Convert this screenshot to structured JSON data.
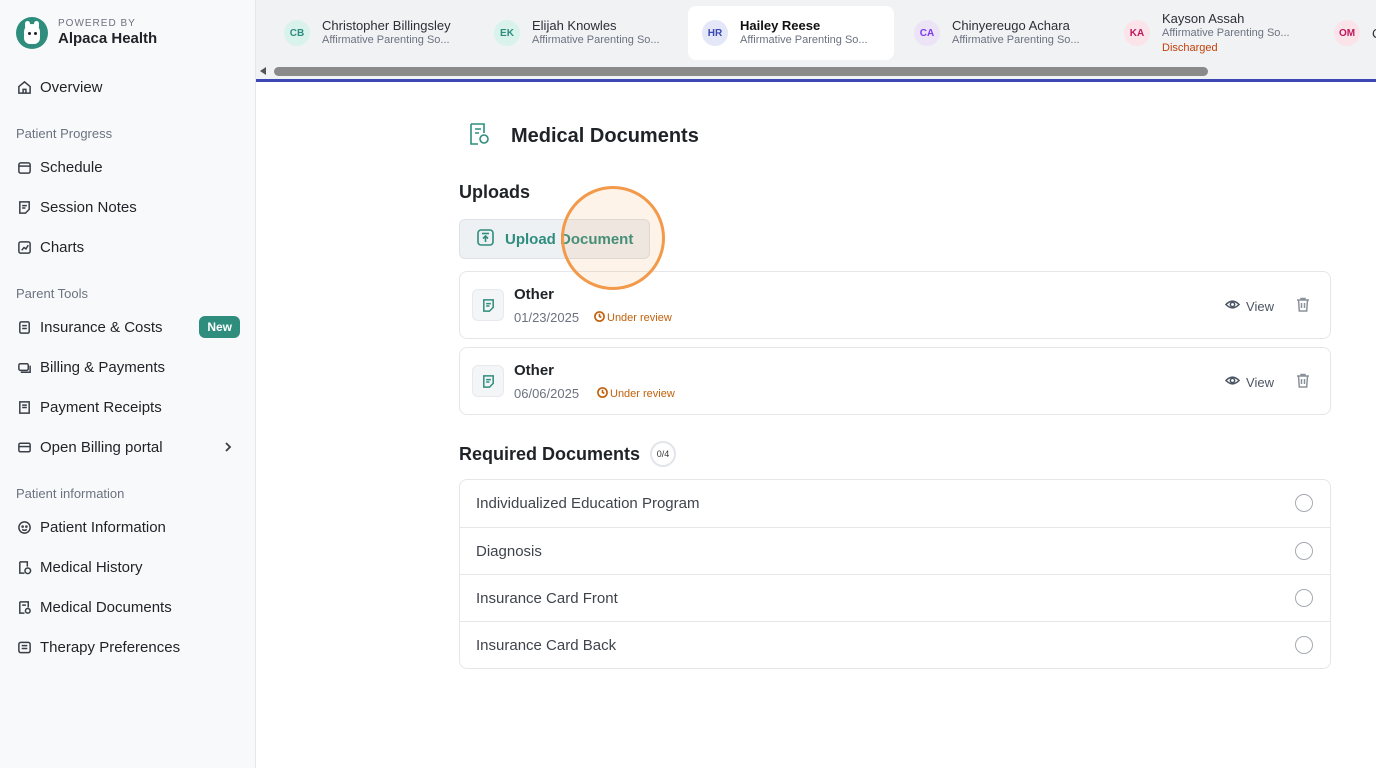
{
  "brand": {
    "powered_by": "POWERED BY",
    "name": "Alpaca Health"
  },
  "sidebar": {
    "overview": "Overview",
    "sections": {
      "progress": "Patient Progress",
      "parent_tools": "Parent Tools",
      "patient_info": "Patient information"
    },
    "items": [
      {
        "label": "Schedule",
        "icon": "calendar-icon"
      },
      {
        "label": "Session Notes",
        "icon": "notes-icon"
      },
      {
        "label": "Charts",
        "icon": "chart-icon"
      },
      {
        "label": "Insurance & Costs",
        "icon": "insurance-icon",
        "badge": "New"
      },
      {
        "label": "Billing & Payments",
        "icon": "billing-icon"
      },
      {
        "label": "Payment Receipts",
        "icon": "receipt-icon"
      },
      {
        "label": "Open Billing portal",
        "icon": "card-icon"
      },
      {
        "label": "Patient Information",
        "icon": "patient-icon"
      },
      {
        "label": "Medical History",
        "icon": "history-icon"
      },
      {
        "label": "Medical Documents",
        "icon": "documents-icon"
      },
      {
        "label": "Therapy Preferences",
        "icon": "preferences-icon"
      }
    ]
  },
  "tabs": [
    {
      "initials": "CB",
      "name": "Christopher Billingsley",
      "org": "Affirmative Parenting So...",
      "bg": "#d9f2ec",
      "fg": "#2f8d7e"
    },
    {
      "initials": "EK",
      "name": "Elijah Knowles",
      "org": "Affirmative Parenting So...",
      "bg": "#d9f2ec",
      "fg": "#2f8d7e"
    },
    {
      "initials": "HR",
      "name": "Hailey Reese",
      "org": "Affirmative Parenting So...",
      "bg": "#e3e7f7",
      "fg": "#3b47b5"
    },
    {
      "initials": "CA",
      "name": "Chinyereugo Achara",
      "org": "Affirmative Parenting So...",
      "bg": "#ece3f7",
      "fg": "#7c3aed"
    },
    {
      "initials": "KA",
      "name": "Kayson Assah",
      "org": "Affirmative Parenting So...",
      "status": "Discharged",
      "bg": "#fbe3ea",
      "fg": "#be185d"
    },
    {
      "initials": "OM",
      "name": "C",
      "org": "",
      "bg": "#fbe3ea",
      "fg": "#be185d"
    }
  ],
  "page": {
    "title": "Medical Documents",
    "uploads_title": "Uploads",
    "upload_button": "Upload Document",
    "documents": [
      {
        "name": "Other",
        "date": "01/23/2025",
        "status": "Under review",
        "view": "View"
      },
      {
        "name": "Other",
        "date": "06/06/2025",
        "status": "Under review",
        "view": "View"
      }
    ],
    "required_title": "Required Documents",
    "required_count": "0/4",
    "required": [
      "Individualized Education Program",
      "Diagnosis",
      "Insurance Card Front",
      "Insurance Card Back"
    ]
  },
  "colors": {
    "brand": "#2f8d7e",
    "accent": "#3b47b5",
    "status": "#c2610c"
  }
}
